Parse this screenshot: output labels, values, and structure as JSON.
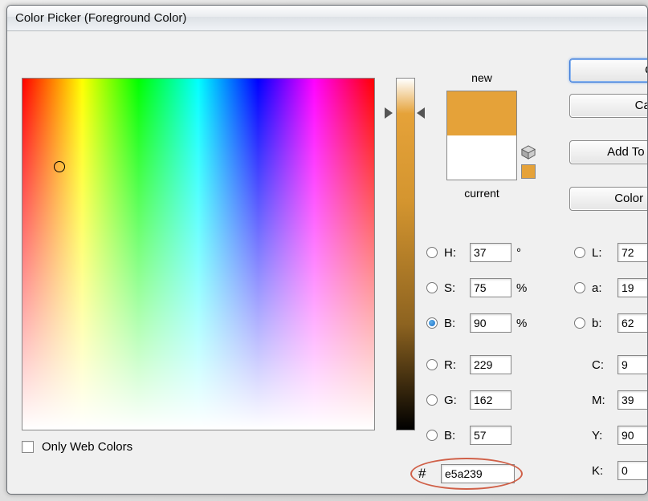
{
  "window": {
    "title": "Color Picker (Foreground Color)"
  },
  "swatch": {
    "new_label": "new",
    "current_label": "current",
    "new_color": "#e5a239",
    "current_color": "#ffffff"
  },
  "buttons": {
    "ok": "OK",
    "cancel": "Cancel",
    "add_swatches": "Add To Swatches",
    "color_libs": "Color Libraries"
  },
  "hsb": {
    "h_label": "H:",
    "h_value": "37",
    "h_unit": "°",
    "s_label": "S:",
    "s_value": "75",
    "s_unit": "%",
    "b_label": "B:",
    "b_value": "90",
    "b_unit": "%",
    "selected": "B"
  },
  "rgb": {
    "r_label": "R:",
    "r_value": "229",
    "g_label": "G:",
    "g_value": "162",
    "b_label": "B:",
    "b_value": "57"
  },
  "lab": {
    "l_label": "L:",
    "l_value": "72",
    "a_label": "a:",
    "a_value": "19",
    "b_label": "b:",
    "b_value": "62"
  },
  "cmyk": {
    "c_label": "C:",
    "c_value": "9",
    "m_label": "M:",
    "m_value": "39",
    "y_label": "Y:",
    "y_value": "90",
    "k_label": "K:",
    "k_value": "0"
  },
  "hex": {
    "prefix": "#",
    "value": "e5a239"
  },
  "web_colors": {
    "label": "Only Web Colors",
    "checked": false
  },
  "picker": {
    "ring_x_pct": 10.5,
    "ring_y_pct": 25,
    "slider_pct": 10
  }
}
